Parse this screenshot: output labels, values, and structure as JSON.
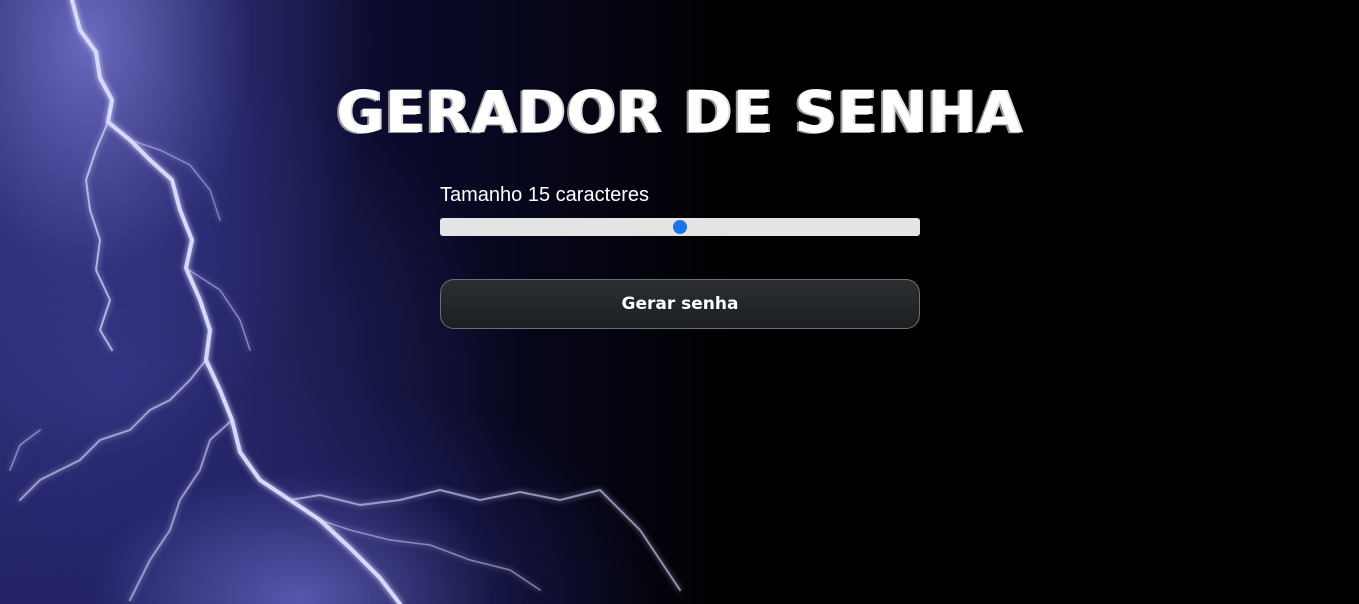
{
  "app": {
    "title": "GERADOR DE SENHA"
  },
  "controls": {
    "size_label_prefix": "Tamanho",
    "size_value": "15",
    "size_label_suffix": "caracteres",
    "slider_fraction": 0.5,
    "generate_button_label": "Gerar senha"
  },
  "colors": {
    "background": "#000000",
    "slider_thumb": "#1a73e8",
    "slider_track": "#e4e4e4",
    "button_bg": "#1c1f21",
    "lightning": "#c9c9ff"
  }
}
